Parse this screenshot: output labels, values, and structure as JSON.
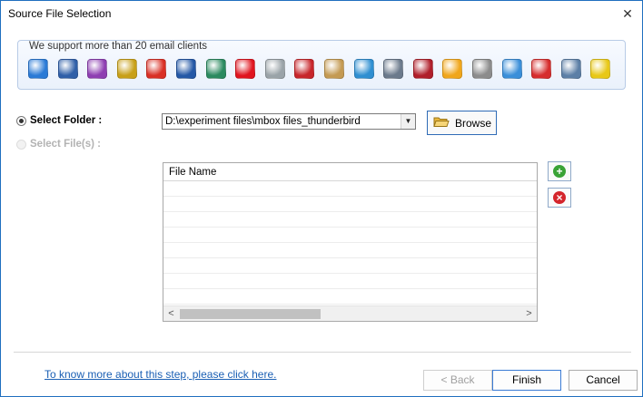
{
  "window": {
    "title": "Source File Selection",
    "close_symbol": "✕"
  },
  "clients": {
    "legend": "We support more than 20 email clients",
    "icons": [
      {
        "name": "mail-client-icon",
        "color": "#2a7ad6"
      },
      {
        "name": "thunderbird-icon",
        "color": "#2f5fa8"
      },
      {
        "name": "entourage-icon",
        "color": "#8e3fb2"
      },
      {
        "name": "claws-mail-icon",
        "color": "#c8a018"
      },
      {
        "name": "gmail-icon",
        "color": "#d93025"
      },
      {
        "name": "postbox-icon",
        "color": "#2458a6"
      },
      {
        "name": "seamonkey-icon",
        "color": "#2b8a5f"
      },
      {
        "name": "opera-mail-icon",
        "color": "#e0151f"
      },
      {
        "name": "mail-clock-icon",
        "color": "#9aa3a8"
      },
      {
        "name": "sylpheed-icon",
        "color": "#c7262b"
      },
      {
        "name": "spicebird-icon",
        "color": "#c49a52"
      },
      {
        "name": "outlook-express-icon",
        "color": "#2f8fd1"
      },
      {
        "name": "mailbox-archive-icon",
        "color": "#6b7a8c"
      },
      {
        "name": "pocomail-icon",
        "color": "#b01f2a"
      },
      {
        "name": "gyazmail-icon",
        "color": "#f0a61b"
      },
      {
        "name": "gnu-mail-icon",
        "color": "#8c8c8c"
      },
      {
        "name": "sparrow-icon",
        "color": "#3b8fd9"
      },
      {
        "name": "apple-mail-icon",
        "color": "#d62d2d"
      },
      {
        "name": "eudora-icon",
        "color": "#5c7fa6"
      },
      {
        "name": "the-bat-icon",
        "color": "#e8c817"
      }
    ]
  },
  "options": {
    "select_folder_label": "Select Folder :",
    "select_files_label": "Select File(s) :"
  },
  "path_select": {
    "value": "D:\\experiment files\\mbox files_thunderbird",
    "arrow": "▼"
  },
  "browse": {
    "label": "Browse"
  },
  "file_table": {
    "header": "File Name",
    "scroll_left": "<",
    "scroll_right": ">"
  },
  "side_buttons": {
    "add_symbol": "+",
    "remove_symbol": "×"
  },
  "footer": {
    "help_link": "To know more about this step, please click here.",
    "back_label": "< Back",
    "finish_label": "Finish",
    "cancel_label": "Cancel"
  }
}
